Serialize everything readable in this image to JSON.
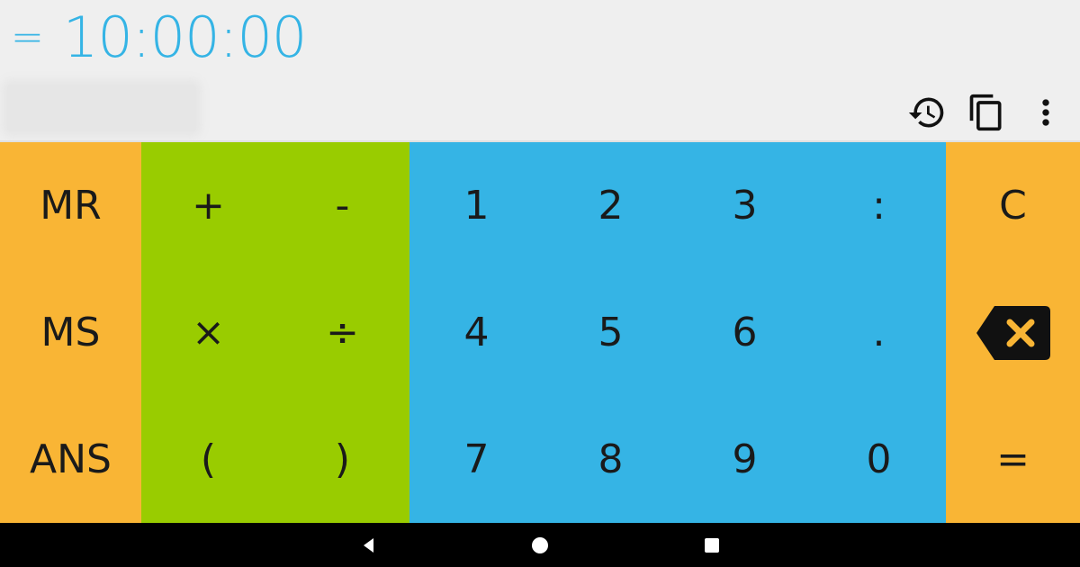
{
  "display": {
    "equals_sign": "=",
    "result": "10:00:00"
  },
  "toolbar": {
    "icons": [
      "history-icon",
      "copy-icon",
      "more-vert-icon"
    ]
  },
  "keys": {
    "mr": "MR",
    "ms": "MS",
    "ans": "ANS",
    "plus": "+",
    "minus": "-",
    "times": "×",
    "divide": "÷",
    "open_paren": "(",
    "close_paren": ")",
    "one": "1",
    "two": "2",
    "three": "3",
    "four": "4",
    "five": "5",
    "six": "6",
    "seven": "7",
    "eight": "8",
    "nine": "9",
    "zero": "0",
    "colon": ":",
    "dot": ".",
    "clear": "C",
    "equals": "="
  },
  "colors": {
    "accent": "#35b4e5",
    "memory_keys": "#f9b535",
    "operator_keys": "#99cc00",
    "number_keys": "#35b4e5",
    "display_bg": "#efefef"
  },
  "navigation": {
    "icons": [
      "back-icon",
      "home-icon",
      "recents-icon"
    ]
  }
}
